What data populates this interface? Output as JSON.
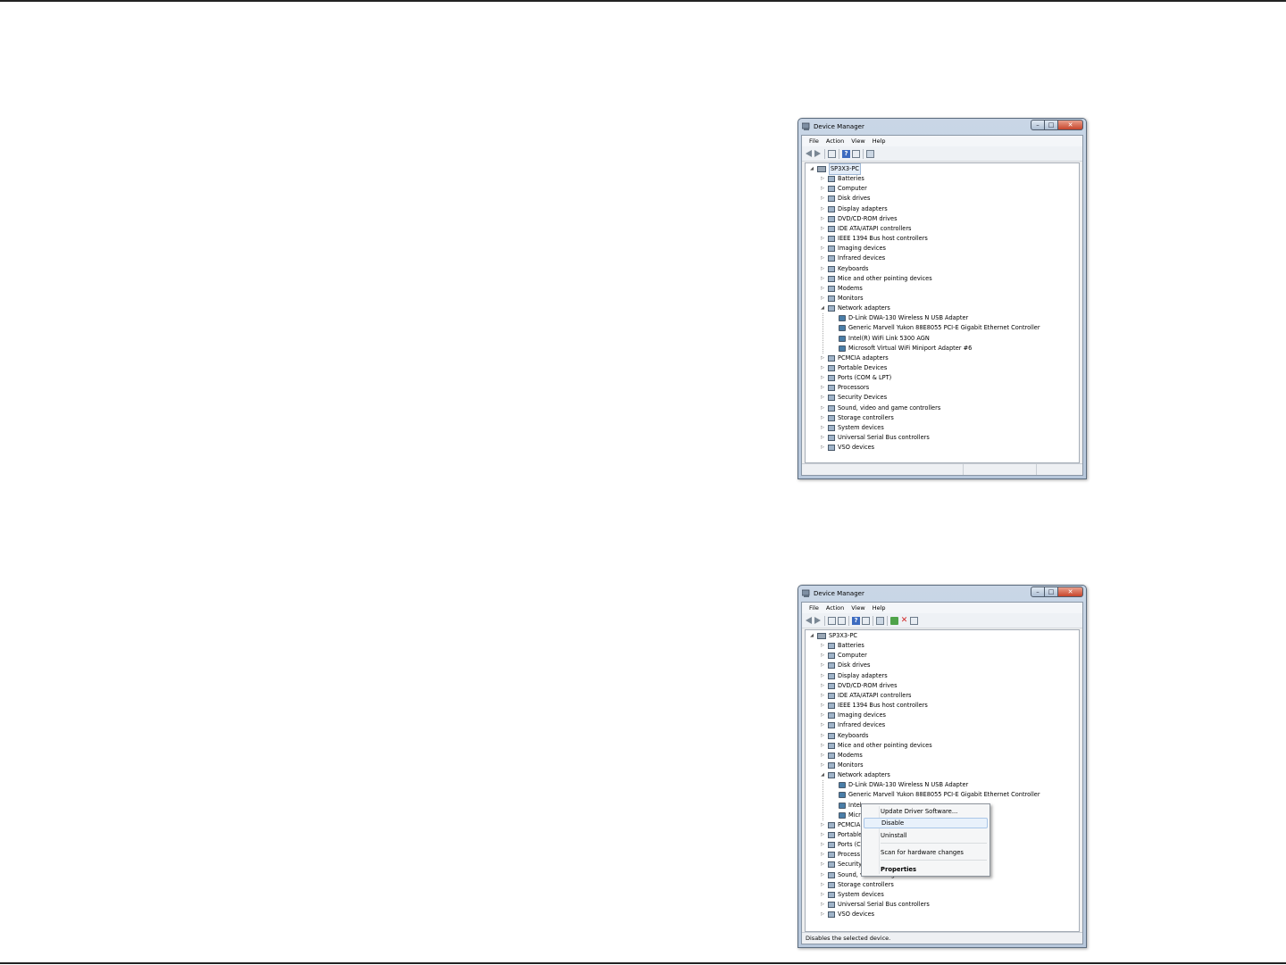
{
  "window1": {
    "title": "Device Manager",
    "menu": [
      "File",
      "Action",
      "View",
      "Help"
    ],
    "computer_name": "SP3X3-PC",
    "categories_before": [
      "Batteries",
      "Computer",
      "Disk drives",
      "Display adapters",
      "DVD/CD-ROM drives",
      "IDE ATA/ATAPI controllers",
      "IEEE 1394 Bus host controllers",
      "Imaging devices",
      "Infrared devices",
      "Keyboards",
      "Mice and other pointing devices",
      "Modems",
      "Monitors",
      "Network adapters"
    ],
    "network_adapters": [
      "D-Link DWA-130 Wireless N USB Adapter",
      "Generic Marvell Yukon 88E8055 PCI-E Gigabit Ethernet Controller",
      "Intel(R) WiFi Link 5300 AGN",
      "Microsoft Virtual WiFi Miniport Adapter #6"
    ],
    "categories_after": [
      "PCMCIA adapters",
      "Portable Devices",
      "Ports (COM & LPT)",
      "Processors",
      "Security Devices",
      "Sound, video and game controllers",
      "Storage controllers",
      "System devices",
      "Universal Serial Bus controllers",
      "VSO devices"
    ],
    "status": ""
  },
  "window2": {
    "title": "Device Manager",
    "menu": [
      "File",
      "Action",
      "View",
      "Help"
    ],
    "computer_name": "SP3X3-PC",
    "categories_before": [
      "Batteries",
      "Computer",
      "Disk drives",
      "Display adapters",
      "DVD/CD-ROM drives",
      "IDE ATA/ATAPI controllers",
      "IEEE 1394 Bus host controllers",
      "Imaging devices",
      "Infrared devices",
      "Keyboards",
      "Mice and other pointing devices",
      "Modems",
      "Monitors",
      "Network adapters"
    ],
    "network_adapters": [
      "D-Link DWA-130 Wireless N USB Adapter",
      "Generic Marvell Yukon 88E8055 PCI-E Gigabit Ethernet Controller",
      "Intel",
      "Micr"
    ],
    "categories_after": [
      "PCMCIA",
      "Portable",
      "Ports (C",
      "Process",
      "Security",
      "Sound, video and game controllers",
      "Storage controllers",
      "System devices",
      "Universal Serial Bus controllers",
      "VSO devices"
    ],
    "status": "Disables the selected device."
  },
  "context_menu": {
    "items": [
      "Update Driver Software...",
      "Disable",
      "Uninstall",
      "Scan for hardware changes",
      "Properties"
    ]
  }
}
